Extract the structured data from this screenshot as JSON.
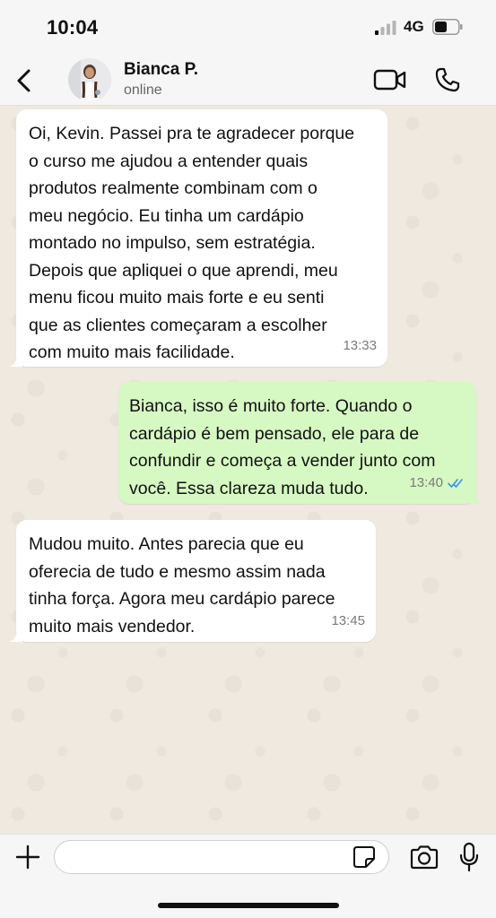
{
  "status_bar": {
    "time": "10:04",
    "network": "4G"
  },
  "header": {
    "contact_name": "Bianca P.",
    "contact_status": "online"
  },
  "messages": [
    {
      "direction": "incoming",
      "text": "Oi, Kevin. Passei pra te agradecer porque\no curso me ajudou a entender quais\nprodutos realmente combinam com o\nmeu negócio. Eu tinha um cardápio\nmontado no impulso, sem estratégia.\nDepois que apliquei o que aprendi, meu\nmenu ficou muito mais forte e eu senti\nque as clientes começaram a escolher\ncom muito mais facilidade.",
      "time": "13:33"
    },
    {
      "direction": "outgoing",
      "text": "Bianca, isso é muito forte. Quando o\ncardápio é bem pensado, ele para de\nconfundir e começa a vender junto com\nvocê. Essa clareza muda tudo.",
      "time": "13:40",
      "read_receipt": "double-check-icon"
    },
    {
      "direction": "incoming",
      "text": "Mudou muito. Antes parecia que eu\noferecia de tudo e mesmo assim nada\ntinha força. Agora meu cardápio parece\nmuito mais vendedor.",
      "time": "13:45"
    }
  ],
  "composer": {
    "value": "",
    "placeholder": ""
  },
  "colors": {
    "outgoing_bubble": "#d6f8c3",
    "incoming_bubble": "#ffffff",
    "read_receipt": "#3b8ff0",
    "chat_background": "#efe9df"
  }
}
